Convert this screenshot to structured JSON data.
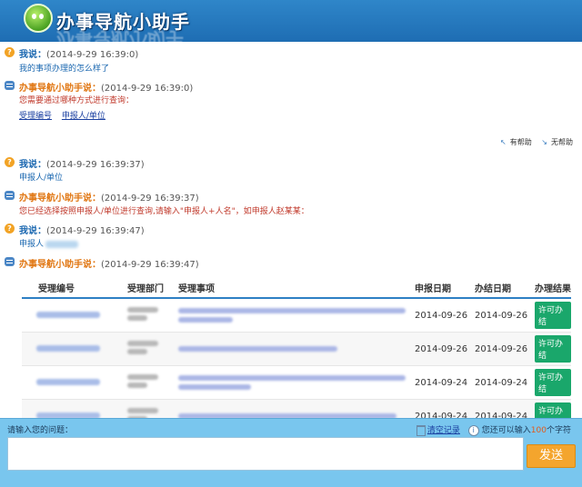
{
  "app": {
    "title": "办事导航小助手"
  },
  "messages": [
    {
      "role": "user",
      "who": "我说：",
      "time": "(2014-9-29 16:39:0)",
      "text": "我的事项办理的怎么样了"
    },
    {
      "role": "bot",
      "who": "办事导航小助手说：",
      "time": "(2014-9-29 16:39:0)",
      "text": "您需要通过哪种方式进行查询：",
      "links": [
        "受理编号",
        "申报人/单位"
      ]
    },
    {
      "role": "user",
      "who": "我说：",
      "time": "(2014-9-29 16:39:37)",
      "text": "申报人/单位"
    },
    {
      "role": "bot",
      "who": "办事导航小助手说：",
      "time": "(2014-9-29 16:39:37)",
      "text": "您已经选择按照申报人/单位进行查询,请输入\"申报人+人名\"，如申报人赵某某："
    },
    {
      "role": "user",
      "who": "我说：",
      "time": "(2014-9-29 16:39:47)",
      "text": "申报人"
    },
    {
      "role": "bot",
      "who": "办事导航小助手说：",
      "time": "(2014-9-29 16:39:47)"
    }
  ],
  "feedback": {
    "helpful": "有帮助",
    "unhelpful": "无帮助"
  },
  "table": {
    "columns": [
      "受理编号",
      "受理部门",
      "受理事项",
      "申报日期",
      "办结日期",
      "办理结果"
    ],
    "rows": [
      {
        "apply_date": "2014-09-26",
        "done_date": "2014-09-26",
        "result": "许可办结"
      },
      {
        "apply_date": "2014-09-26",
        "done_date": "2014-09-26",
        "result": "许可办结"
      },
      {
        "apply_date": "2014-09-24",
        "done_date": "2014-09-24",
        "result": "许可办结"
      },
      {
        "apply_date": "2014-09-24",
        "done_date": "2014-09-24",
        "result": "许可办结"
      }
    ]
  },
  "input": {
    "prompt": "请输入您的问题：",
    "clear": "清空记录",
    "limit_prefix": "您还可以输入",
    "limit_value": "100",
    "limit_suffix": "个字符",
    "value": "",
    "send": "发送"
  },
  "colors": {
    "header": "#1e6db3",
    "input_bar": "#79c6ee",
    "send_button": "#f4a52d",
    "result_badge": "#1aa76b"
  }
}
